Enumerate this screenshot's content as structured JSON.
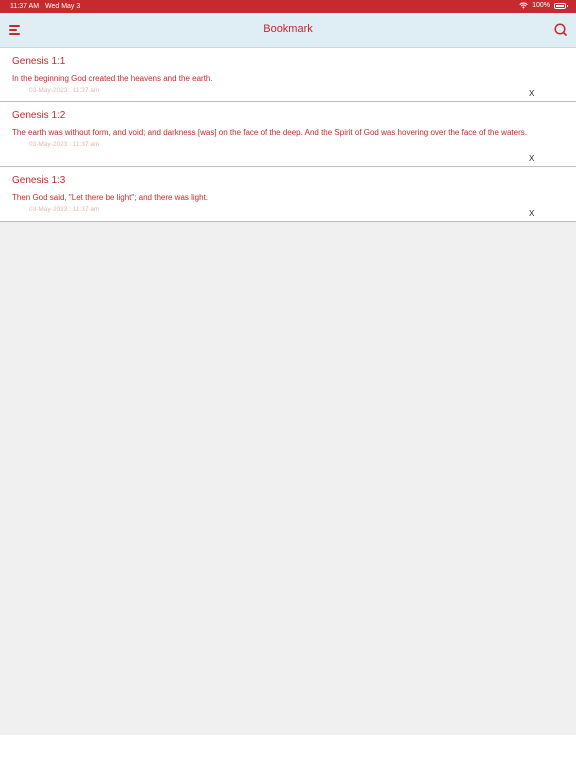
{
  "status_bar": {
    "time": "11:37 AM",
    "date": "Wed May 3",
    "battery": "100%"
  },
  "nav": {
    "title": "Bookmark",
    "menu_icon": "menu-icon",
    "search_icon": "search-icon"
  },
  "bookmarks": [
    {
      "reference": "Genesis 1:1",
      "verse": "In the beginning God created the heavens and the earth.",
      "timestamp": "03-May-2023 : 11:37 am",
      "delete_label": "X"
    },
    {
      "reference": "Genesis 1:2",
      "verse": "The earth was without form, and void; and darkness [was] on the face of the deep. And the Spirit of God was hovering over the face of the waters.",
      "timestamp": "03-May-2023 : 11:37 am",
      "delete_label": "X"
    },
    {
      "reference": "Genesis 1:3",
      "verse": "Then God said, \"Let there be light\"; and there was light.",
      "timestamp": "03-May-2023 : 11:37 am",
      "delete_label": "X"
    }
  ],
  "colors": {
    "accent": "#c62a2e",
    "nav_background": "#dfedf5",
    "empty_background": "#f0f0f0"
  }
}
